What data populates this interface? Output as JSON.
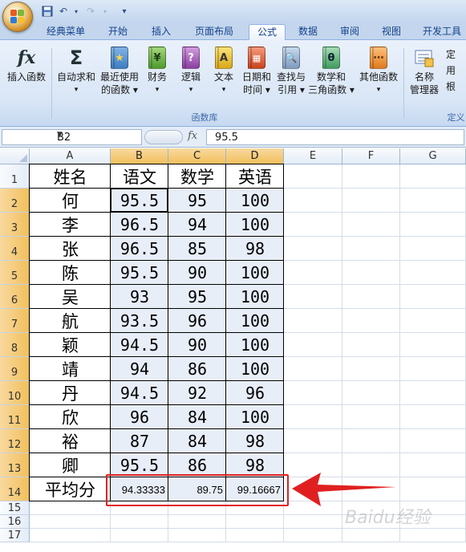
{
  "quick_access": {
    "save_icon": "save-icon",
    "undo_icon": "undo-icon",
    "redo_icon": "redo-icon"
  },
  "tabs": [
    "经典菜单",
    "开始",
    "插入",
    "页面布局",
    "公式",
    "数据",
    "审阅",
    "视图",
    "开发工具"
  ],
  "active_tab": "公式",
  "ribbon": {
    "buttons": [
      {
        "label": "插入函数",
        "label2": "",
        "icon": "fx"
      },
      {
        "label": "自动求和",
        "label2": "▾",
        "icon": "Σ"
      },
      {
        "label": "最近使用",
        "label2": "的函数 ▾",
        "icon": "★"
      },
      {
        "label": "财务",
        "label2": "▾",
        "icon": "¥"
      },
      {
        "label": "逻辑",
        "label2": "▾",
        "icon": "?"
      },
      {
        "label": "文本",
        "label2": "▾",
        "icon": "A"
      },
      {
        "label": "日期和",
        "label2": "时间 ▾",
        "icon": "▦"
      },
      {
        "label": "查找与",
        "label2": "引用 ▾",
        "icon": "🔍"
      },
      {
        "label": "数学和",
        "label2": "三角函数 ▾",
        "icon": "θ"
      },
      {
        "label": "其他函数",
        "label2": "▾",
        "icon": "⋯"
      },
      {
        "label": "名称",
        "label2": "管理器",
        "icon": "▤"
      }
    ],
    "side_items": [
      "定",
      "用",
      "根"
    ],
    "group_label": "函数库",
    "group_label_right": "定义"
  },
  "formula_bar": {
    "name_box": "B2",
    "fx_label": "fx",
    "value": "95.5"
  },
  "columns": [
    "A",
    "B",
    "C",
    "D",
    "E",
    "F",
    "G"
  ],
  "rows": [
    "1",
    "2",
    "3",
    "4",
    "5",
    "6",
    "7",
    "8",
    "9",
    "10",
    "11",
    "12",
    "13",
    "14",
    "15",
    "16",
    "17"
  ],
  "sheet": {
    "header": [
      "姓名",
      "语文",
      "数学",
      "英语"
    ],
    "records": [
      [
        "何",
        "95.5",
        "95",
        "100"
      ],
      [
        "李",
        "96.5",
        "94",
        "100"
      ],
      [
        "张",
        "96.5",
        "85",
        "98"
      ],
      [
        "陈",
        "95.5",
        "90",
        "100"
      ],
      [
        "吴",
        "93",
        "95",
        "100"
      ],
      [
        "航",
        "93.5",
        "96",
        "100"
      ],
      [
        "颖",
        "94.5",
        "90",
        "100"
      ],
      [
        "靖",
        "94",
        "86",
        "100"
      ],
      [
        "丹",
        "94.5",
        "92",
        "96"
      ],
      [
        "欣",
        "96",
        "84",
        "100"
      ],
      [
        "裕",
        "87",
        "84",
        "98"
      ],
      [
        "卿",
        "95.5",
        "86",
        "98"
      ]
    ],
    "average_label": "平均分",
    "averages": [
      "94.33333",
      "89.75",
      "99.16667"
    ]
  },
  "annotation_color": "#e02020",
  "watermark": "Baidu经验"
}
